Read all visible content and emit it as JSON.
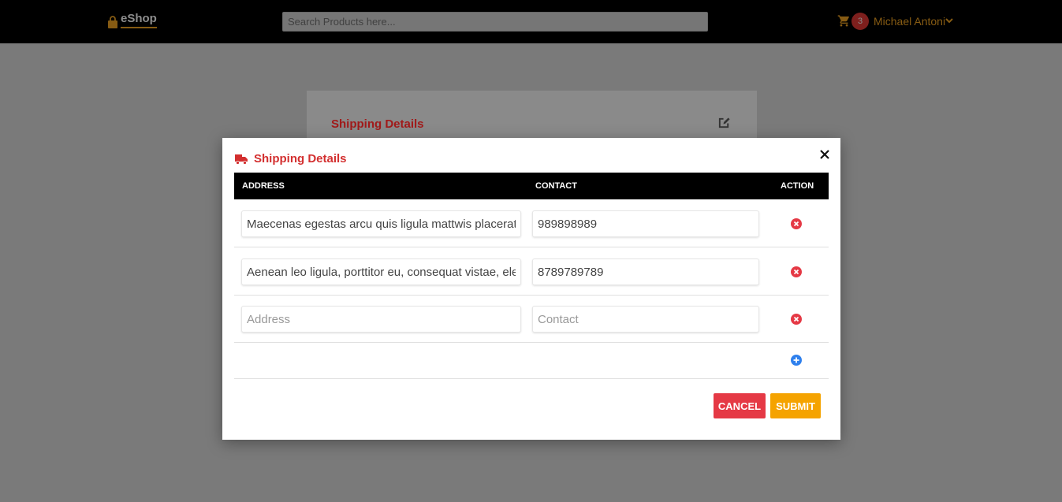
{
  "header": {
    "logo_text": "eShop",
    "search_placeholder": "Search Products here...",
    "cart_count": "3",
    "user_name": "Michael Antoni"
  },
  "background_card": {
    "title": "Shipping Details"
  },
  "modal": {
    "title": "Shipping Details",
    "columns": [
      "ADDRESS",
      "CONTACT",
      "ACTION"
    ],
    "rows": [
      {
        "address": "Maecenas egestas arcu quis ligula mattwis placerat. Aenean",
        "contact": "989898989"
      },
      {
        "address": "Aenean leo ligula, porttitor eu, consequat vistae, eleifend ac",
        "contact": "8789789789"
      },
      {
        "address": "",
        "contact": ""
      }
    ],
    "address_placeholder": "Address",
    "contact_placeholder": "Contact",
    "cancel_label": "CANCEL",
    "submit_label": "SUBMIT"
  },
  "colors": {
    "accent": "#f5a623",
    "danger": "#e53945",
    "submit": "#f5a300",
    "title_red": "#d32f2f",
    "add_blue": "#2f80ed"
  },
  "icons": [
    "lock-bag-icon",
    "cart-icon",
    "chevron-down-icon",
    "edit-icon",
    "truck-icon",
    "close-icon",
    "remove-circle-icon",
    "add-circle-icon"
  ]
}
